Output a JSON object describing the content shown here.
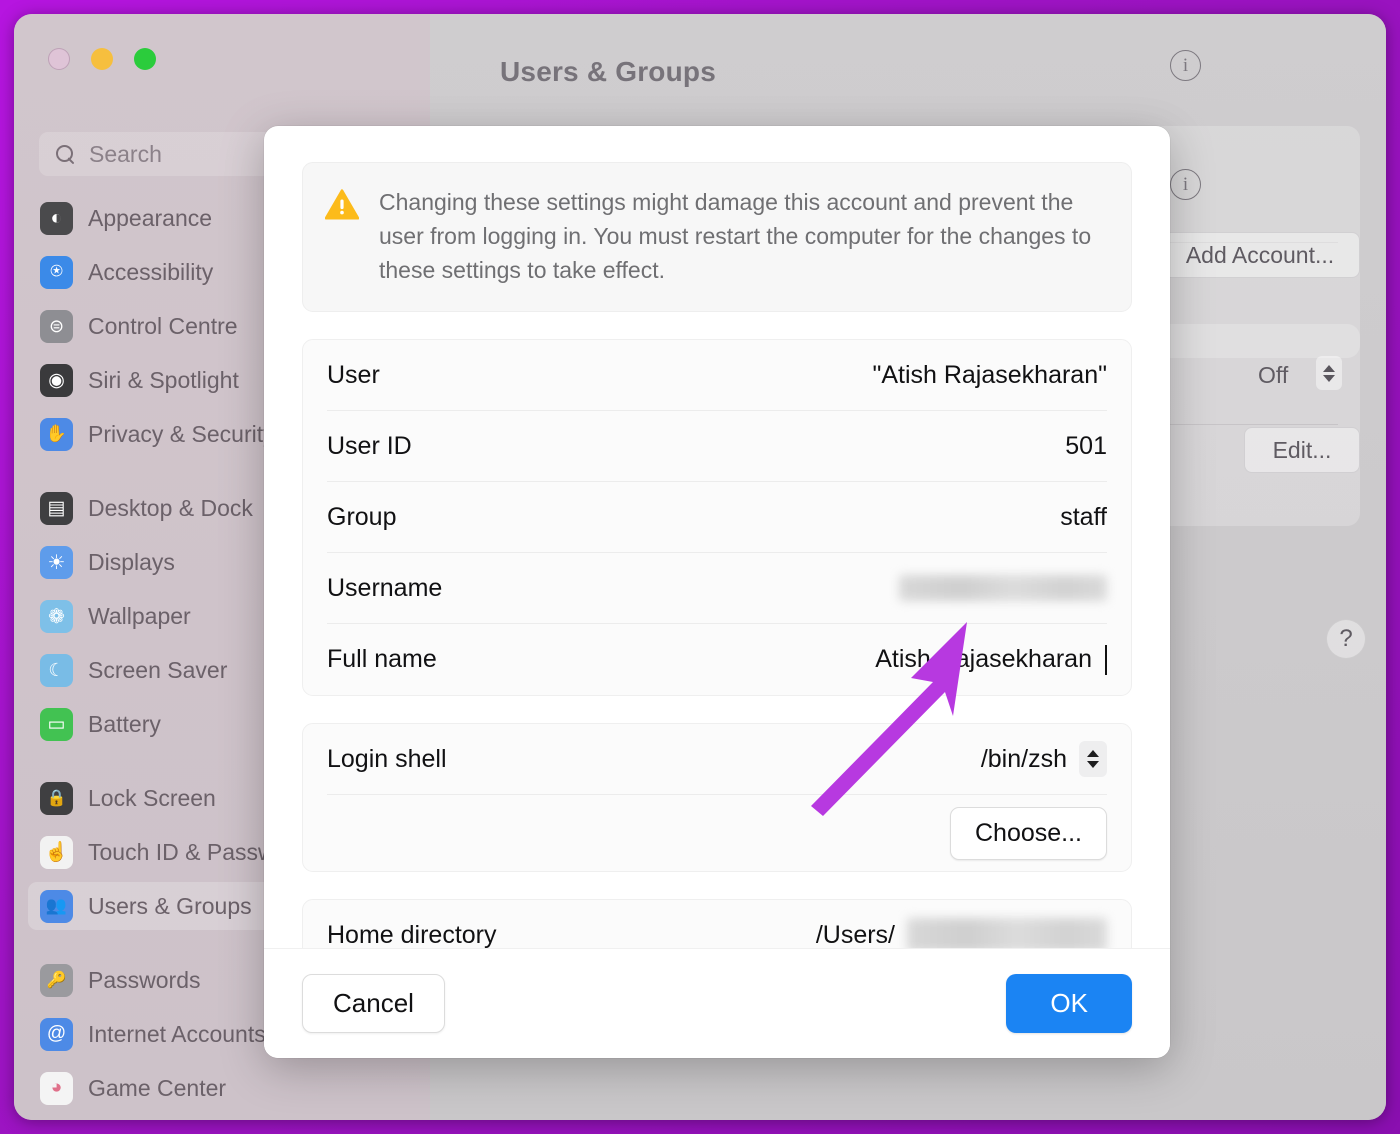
{
  "window": {
    "title": "Users & Groups",
    "traffic_lights": [
      "close",
      "minimize",
      "maximize"
    ]
  },
  "search": {
    "placeholder": "Search",
    "icon": "search-icon"
  },
  "sidebar": {
    "items": [
      {
        "label": "Appearance",
        "icon": "appearance-icon",
        "selected": false,
        "gap_before": false
      },
      {
        "label": "Accessibility",
        "icon": "accessibility-icon",
        "selected": false,
        "gap_before": false
      },
      {
        "label": "Control Centre",
        "icon": "control-centre-icon",
        "selected": false,
        "gap_before": false
      },
      {
        "label": "Siri & Spotlight",
        "icon": "siri-spotlight-icon",
        "selected": false,
        "gap_before": false
      },
      {
        "label": "Privacy & Security",
        "icon": "privacy-security-icon",
        "selected": false,
        "gap_before": false
      },
      {
        "label": "Desktop & Dock",
        "icon": "desktop-dock-icon",
        "selected": false,
        "gap_before": true
      },
      {
        "label": "Displays",
        "icon": "displays-icon",
        "selected": false,
        "gap_before": false
      },
      {
        "label": "Wallpaper",
        "icon": "wallpaper-icon",
        "selected": false,
        "gap_before": false
      },
      {
        "label": "Screen Saver",
        "icon": "screen-saver-icon",
        "selected": false,
        "gap_before": false
      },
      {
        "label": "Battery",
        "icon": "battery-icon",
        "selected": false,
        "gap_before": false
      },
      {
        "label": "Lock Screen",
        "icon": "lock-screen-icon",
        "selected": false,
        "gap_before": true
      },
      {
        "label": "Touch ID & Password",
        "icon": "touch-id-icon",
        "selected": false,
        "gap_before": false
      },
      {
        "label": "Users & Groups",
        "icon": "users-groups-icon",
        "selected": true,
        "gap_before": false
      },
      {
        "label": "Passwords",
        "icon": "passwords-icon",
        "selected": false,
        "gap_before": true
      },
      {
        "label": "Internet Accounts",
        "icon": "internet-accounts-icon",
        "selected": false,
        "gap_before": false
      },
      {
        "label": "Game Center",
        "icon": "game-center-icon",
        "selected": false,
        "gap_before": false
      }
    ]
  },
  "background_pane": {
    "add_account_label": "Add Account...",
    "edit_label": "Edit...",
    "automatic_login_value": "Off",
    "help_label": "?",
    "info_icon": "info-icon"
  },
  "modal": {
    "warning": {
      "icon": "warning-triangle-icon",
      "text": "Changing these settings might damage this account and prevent the user from logging in. You must restart the computer for the changes to these settings to take effect."
    },
    "fields": [
      {
        "label": "User",
        "value": "\"Atish Rajasekharan\"",
        "kind": "text"
      },
      {
        "label": "User ID",
        "value": "501",
        "kind": "text"
      },
      {
        "label": "Group",
        "value": "staff",
        "kind": "text"
      },
      {
        "label": "Username",
        "value": "",
        "kind": "redacted"
      },
      {
        "label": "Full name",
        "value": "Atish Rajasekharan",
        "kind": "editing"
      }
    ],
    "login_shell": {
      "label": "Login shell",
      "value": "/bin/zsh",
      "stepper_icon": "up-down-chevron-icon",
      "choose_label": "Choose..."
    },
    "home_directory": {
      "label": "Home directory",
      "value_prefix": "/Users/",
      "value_redacted": true
    },
    "footer": {
      "cancel_label": "Cancel",
      "ok_label": "OK"
    }
  },
  "annotation": {
    "arrow_color": "#b739e0",
    "points_to": "full-name-field"
  },
  "colors": {
    "accent_blue": "#1b84f3",
    "warning_yellow": "#fcbb1b",
    "border_magenta": "#a212c9",
    "sidebar_mauve": "#cdc0c8"
  }
}
